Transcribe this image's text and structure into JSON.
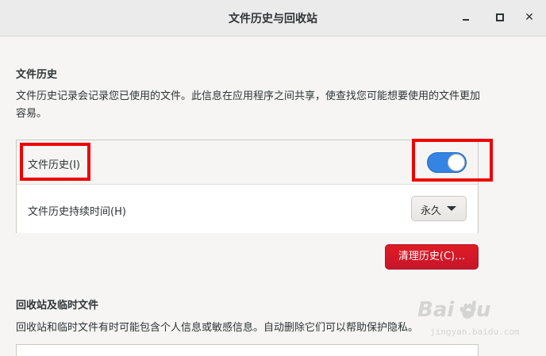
{
  "window": {
    "title": "文件历史与回收站"
  },
  "file_history": {
    "section_title": "文件历史",
    "description": "文件历史记录会记录您已使用的文件。此信息在应用程序之间共享，使查找您可能想要使用的文件更加容易。",
    "toggle_label": "文件历史(I)",
    "toggle_on": true,
    "duration_label": "文件历史持续时间(H)",
    "duration_value": "永久",
    "clear_button_label": "清理历史(C)…"
  },
  "trash": {
    "section_title": "回收站及临时文件",
    "description": "回收站和临时文件有时可能包含个人信息或敏感信息。自动删除它们可以帮助保护隐私。"
  },
  "watermark": {
    "logo_text": "Bai du",
    "sub_text": "jingyan.baidu.com"
  },
  "colors": {
    "accent": "#3584e4",
    "destructive": "#e01b24",
    "annotation": "#ee0000"
  }
}
